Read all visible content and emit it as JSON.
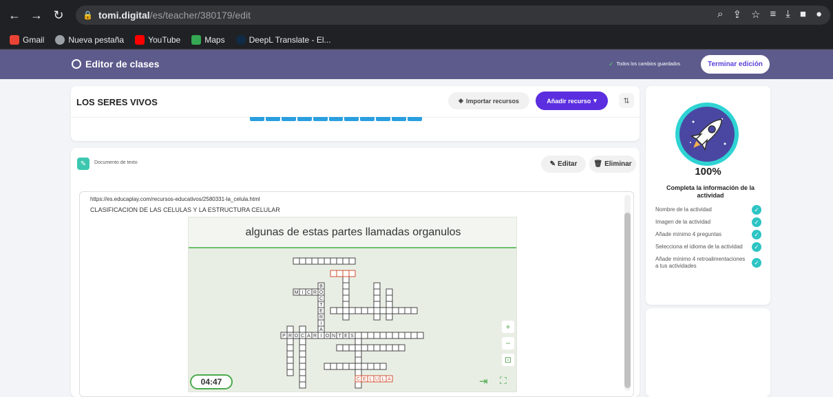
{
  "browser": {
    "url_domain": "tomi.digital",
    "url_path": "/es/teacher/380179/edit",
    "bookmarks": [
      {
        "label": "Gmail",
        "color": "#ea4335"
      },
      {
        "label": "Nueva pestaña",
        "color": "#9aa0a6"
      },
      {
        "label": "YouTube",
        "color": "#ff0000"
      },
      {
        "label": "Maps",
        "color": "#34a853"
      },
      {
        "label": "DeepL Translate - El...",
        "color": "#0f2b46"
      }
    ]
  },
  "app": {
    "title": "Editor de clases",
    "saved_status": "Todos los cambios guardados",
    "finish_button": "Terminar edición"
  },
  "lesson": {
    "title": "LOS SERES VIVOS",
    "import_button": "Importar recursos",
    "add_button": "Añadir recurso"
  },
  "resource": {
    "type_label": "Documento de texto",
    "edit_button": "Editar",
    "delete_button": "Eliminar",
    "url_text": "https://es.educaplay.com/recursos-educativos/2580331-la_celula.html",
    "heading": "CLASIFICACION DE LAS CELULAS Y LA ESTRUCTURA CELULAR",
    "game": {
      "prompt": "algunas de estas partes llamadas organulos",
      "timer": "04:47",
      "zoom_in": "+",
      "zoom_out": "−"
    }
  },
  "sidebar": {
    "progress": "100%",
    "progress_value": 100,
    "complete_title": "Completa la información de la actividad",
    "checks": [
      "Nombre de la actividad",
      "Imagen de la actividad",
      "Añade mínimo 4 preguntas",
      "Selecciona el idioma de la actividad",
      "Añade mínimo 4 retroalimentaciones a tus actividades"
    ]
  }
}
